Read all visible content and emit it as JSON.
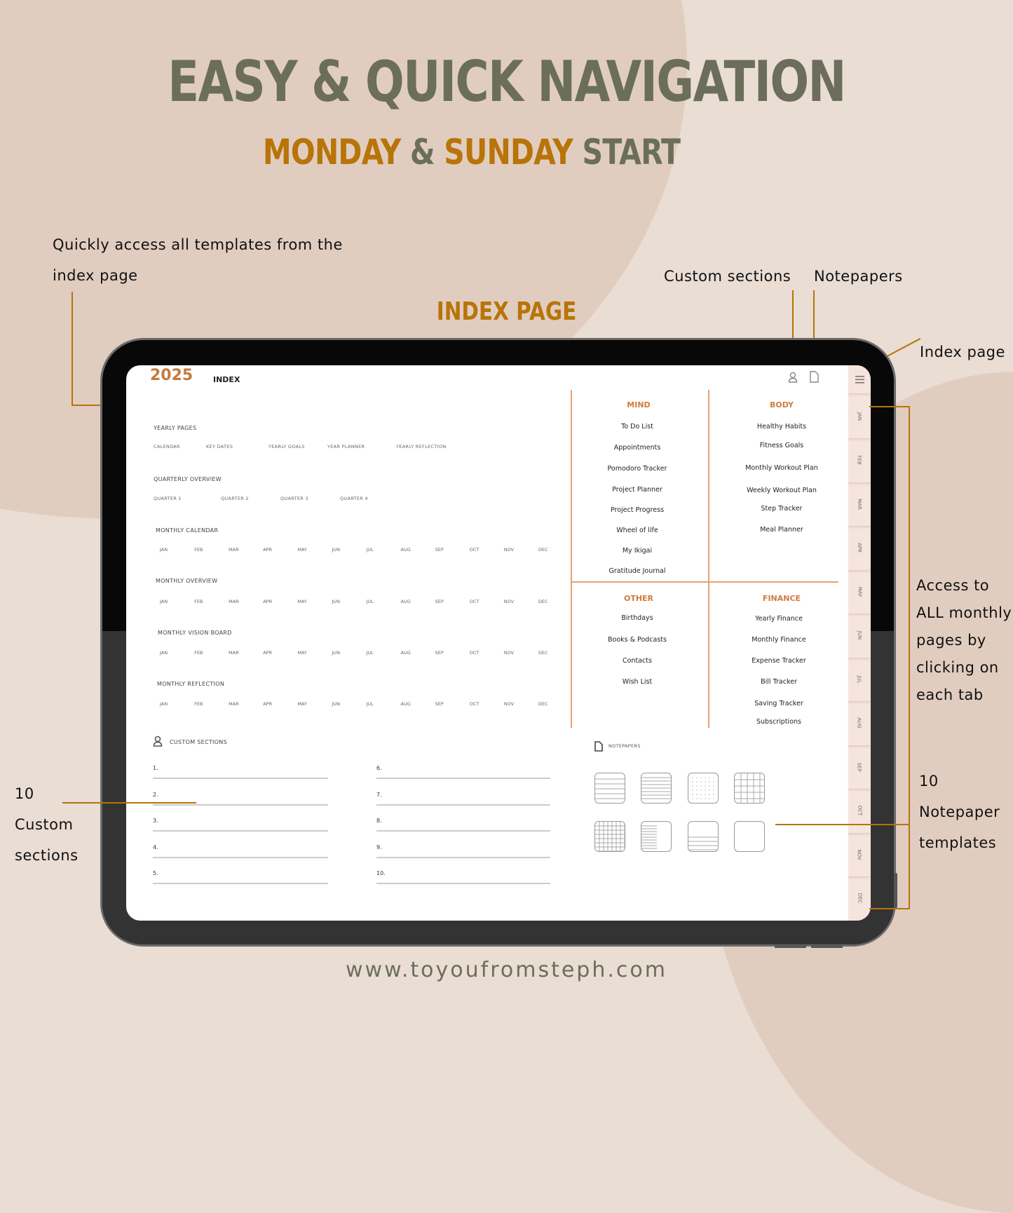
{
  "header": {
    "title": "EASY & QUICK NAVIGATION",
    "subtitle_parts": [
      "MONDAY",
      " & ",
      "SUNDAY",
      " START"
    ],
    "section_label": "INDEX PAGE"
  },
  "annotations": {
    "index_templates_line1": "Quickly access all templates from the",
    "index_templates_line2": "index page",
    "custom_sections": "Custom sections",
    "notepapers": "Notepapers",
    "index_page": "Index page",
    "monthly_access": [
      "Access to",
      "ALL monthly",
      "pages by",
      "clicking on",
      "each tab"
    ],
    "custom_count": [
      "10",
      "Custom",
      "sections"
    ],
    "notepaper_count": [
      "10",
      "Notepaper",
      "templates"
    ]
  },
  "footer": {
    "url": "www.toyoufromsteph.com"
  },
  "colors": {
    "accent_orange": "#b87408",
    "title_green": "#6b6e5a",
    "category_orange": "#d07c3c",
    "background": "#e9ddd4"
  },
  "screen": {
    "year": "2025",
    "page_title": "INDEX",
    "top_icons": [
      "person-icon",
      "document-icon"
    ],
    "yearly_pages": {
      "heading": "YEARLY PAGES",
      "items": [
        "CALENDAR",
        "KEY DATES",
        "YEARLY GOALS",
        "YEAR PLANNER",
        "YEARLY REFLECTION"
      ]
    },
    "quarterly": {
      "heading": "QUARTERLY OVERVIEW",
      "items": [
        "QUARTER 1",
        "QUARTER 2",
        "QUARTER 3",
        "QUARTER 4"
      ]
    },
    "monthly_sections": [
      {
        "heading": "MONTHLY CALENDAR"
      },
      {
        "heading": "MONTHLY OVERVIEW"
      },
      {
        "heading": "MONTHLY VISION BOARD"
      },
      {
        "heading": "MONTHLY REFLECTION"
      }
    ],
    "months": [
      "JAN",
      "FEB",
      "MAR",
      "APR",
      "MAY",
      "JUN",
      "JUL",
      "AUG",
      "SEP",
      "OCT",
      "NOV",
      "DEC"
    ],
    "categories": {
      "mind": {
        "heading": "MIND",
        "items": [
          "To Do List",
          "Appointments",
          "Pomodoro Tracker",
          "Project Planner",
          "Project Progress",
          "Wheel of life",
          "My Ikigai",
          "Gratitude Journal"
        ]
      },
      "body": {
        "heading": "BODY",
        "items": [
          "Healthy Habits",
          "Fitness Goals",
          "Monthly Workout Plan",
          "Weekly Workout Plan",
          "Step Tracker",
          "Meal Planner"
        ]
      },
      "other": {
        "heading": "OTHER",
        "items": [
          "Birthdays",
          "Books & Podcasts",
          "Contacts",
          "Wish List"
        ]
      },
      "finance": {
        "heading": "FINANCE",
        "items": [
          "Yearly Finance",
          "Monthly Finance",
          "Expense Tracker",
          "Bill Tracker",
          "Saving Tracker",
          "Subscriptions"
        ]
      }
    },
    "custom_sections": {
      "heading": "CUSTOM SECTIONS",
      "rows": [
        "1.",
        "2.",
        "3.",
        "4.",
        "5.",
        "6.",
        "7.",
        "8.",
        "9.",
        "10."
      ]
    },
    "notepapers": {
      "heading": "NOTEPAPERS",
      "templates": [
        "wide-ruled",
        "narrow-ruled",
        "dot-grid",
        "large-grid",
        "small-grid",
        "cornell",
        "bottom-lined",
        "blank"
      ]
    },
    "side_tabs": [
      "JAN",
      "FEB",
      "MAR",
      "APR",
      "MAY",
      "JUN",
      "JUL",
      "AUG",
      "SEP",
      "OCT",
      "NOV",
      "DEC"
    ],
    "menu_icon": "hamburger-icon"
  }
}
